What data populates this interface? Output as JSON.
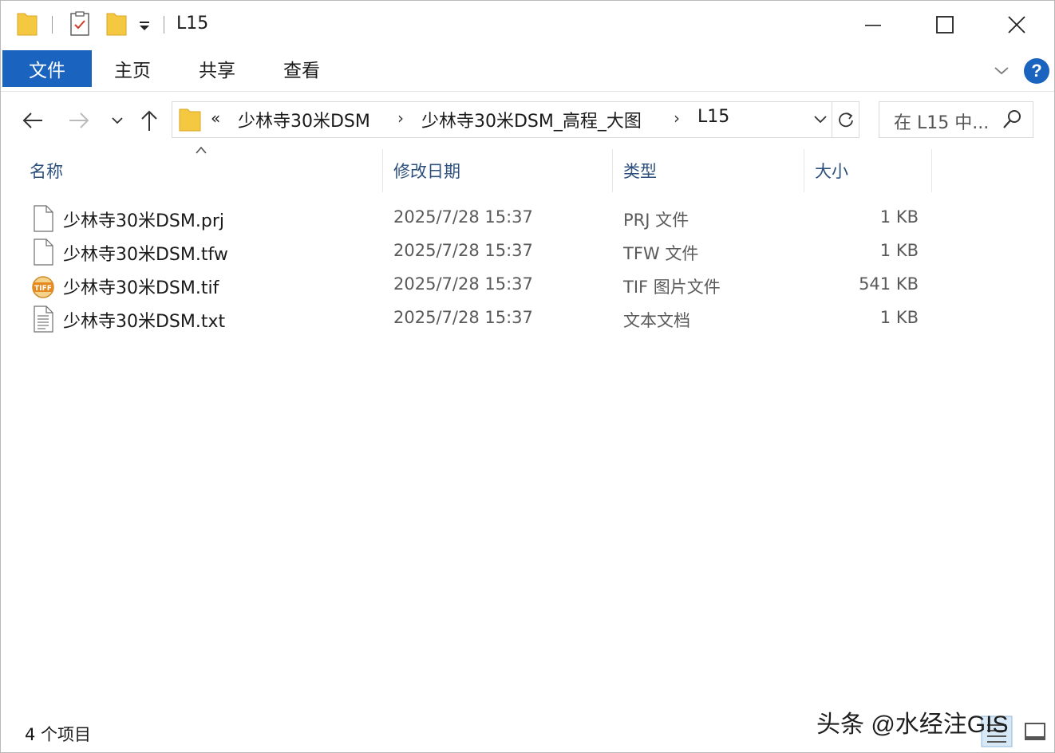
{
  "window": {
    "title": "L15"
  },
  "ribbon": {
    "tabs": [
      {
        "label": "文件"
      },
      {
        "label": "主页"
      },
      {
        "label": "共享"
      },
      {
        "label": "查看"
      }
    ],
    "help_label": "?"
  },
  "address": {
    "overflow": "«",
    "crumbs": [
      "少林寺30米DSM",
      "少林寺30米DSM_高程_大图",
      "L15"
    ],
    "separator": "›"
  },
  "search": {
    "placeholder": "在 L15 中..."
  },
  "columns": {
    "name": "名称",
    "modified": "修改日期",
    "type": "类型",
    "size": "大小"
  },
  "files": [
    {
      "name": "少林寺30米DSM.prj",
      "modified": "2025/7/28 15:37",
      "type": "PRJ 文件",
      "size": "1 KB",
      "icon": "blank-file-icon"
    },
    {
      "name": "少林寺30米DSM.tfw",
      "modified": "2025/7/28 15:37",
      "type": "TFW 文件",
      "size": "1 KB",
      "icon": "blank-file-icon"
    },
    {
      "name": "少林寺30米DSM.tif",
      "modified": "2025/7/28 15:37",
      "type": "TIF 图片文件",
      "size": "541 KB",
      "icon": "tiff-file-icon"
    },
    {
      "name": "少林寺30米DSM.txt",
      "modified": "2025/7/28 15:37",
      "type": "文本文档",
      "size": "1 KB",
      "icon": "text-file-icon"
    }
  ],
  "status": {
    "item_count": "4 个项目"
  },
  "watermark": "头条 @水经注GIS",
  "colors": {
    "accent": "#1a64c0",
    "header_text": "#2c4f7c",
    "folder": "#f5c842"
  }
}
